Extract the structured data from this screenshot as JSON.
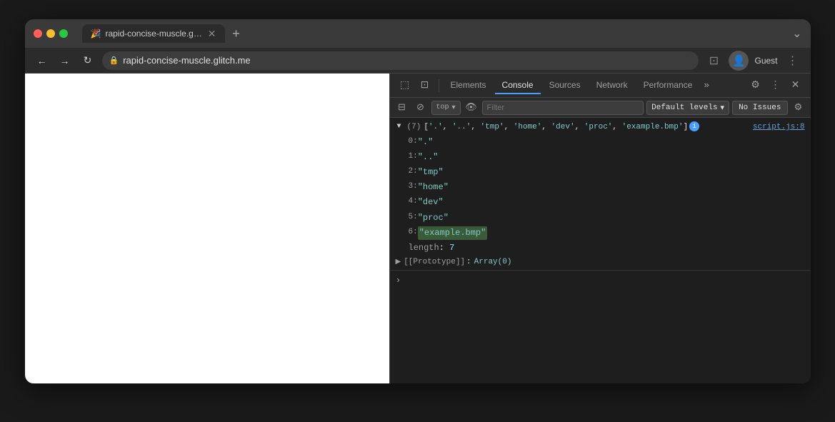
{
  "browser": {
    "title": "rapid-concise-muscle.glitch.me",
    "tab_label": "rapid-concise-muscle.glitch.m...",
    "tab_icon": "🎉",
    "url": "rapid-concise-muscle.glitch.me",
    "profile_label": "Guest",
    "new_tab_btn": "+",
    "expand_btn": "⌄"
  },
  "nav": {
    "back": "←",
    "forward": "→",
    "refresh": "↻"
  },
  "devtools": {
    "tabs": [
      "Elements",
      "Console",
      "Sources",
      "Network",
      "Performance"
    ],
    "active_tab": "Console",
    "more_tabs": "»",
    "settings_icon": "⚙",
    "more_icon": "⋮",
    "close_icon": "✕"
  },
  "console_toolbar": {
    "inspect_icon": "⬚",
    "device_icon": "⊡",
    "no_entry_icon": "⊘",
    "top_label": "top",
    "dropdown_arrow": "▾",
    "eye_icon": "👁",
    "filter_placeholder": "Filter",
    "default_levels_label": "Default levels",
    "dropdown_arrow2": "▾",
    "no_issues_label": "No Issues",
    "settings2_icon": "⚙"
  },
  "console_output": {
    "array_summary": "(7) ['.', '..', 'tmp', 'home', 'dev', 'proc', 'example.bmp']",
    "script_ref": "script.js:8",
    "items": [
      {
        "index": "0:",
        "value": "\".\""
      },
      {
        "index": "1:",
        "value": "\"..\""
      },
      {
        "index": "2:",
        "value": "\"tmp\""
      },
      {
        "index": "3:",
        "value": "\"home\""
      },
      {
        "index": "4:",
        "value": "\"dev\""
      },
      {
        "index": "5:",
        "value": "\"proc\""
      },
      {
        "index": "6:",
        "value": "\"example.bmp\"",
        "highlight": true
      }
    ],
    "length_label": "length",
    "length_value": "7",
    "prototype_text": "[[Prototype]]",
    "prototype_value": "Array(0)"
  }
}
